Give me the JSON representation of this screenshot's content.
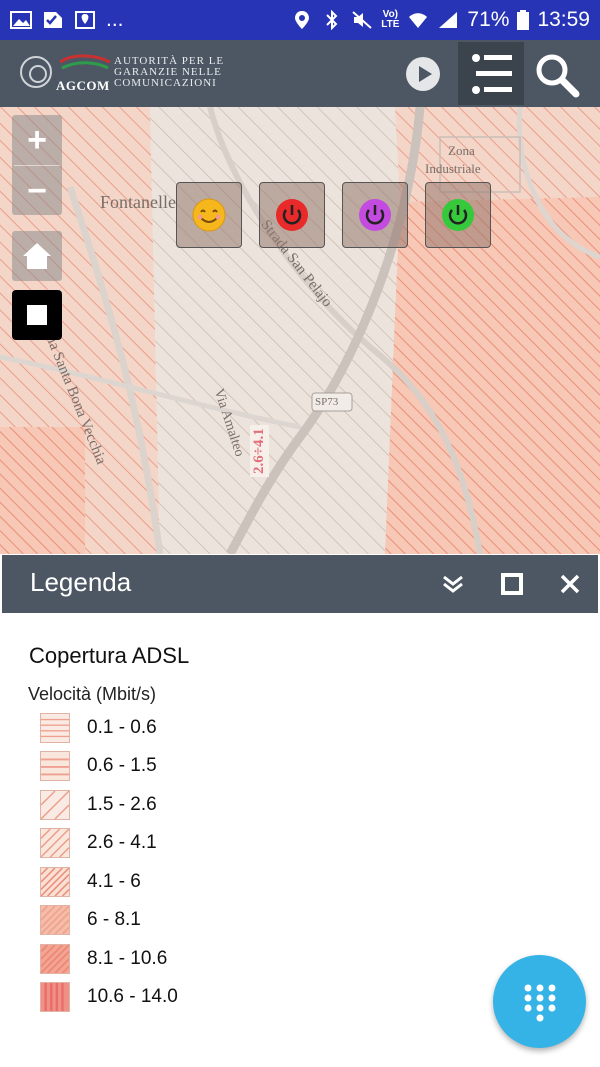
{
  "status_bar": {
    "dots": "...",
    "network_top": "Vo)",
    "network_bottom": "LTE",
    "battery": "71%",
    "time": "13:59"
  },
  "header": {
    "logo_lines": [
      "AUTORITÀ PER LE",
      "GARANZIE NELLE",
      "COMUNICAZIONI"
    ],
    "logo_brand": "AGCOM",
    "play_icon": "play-circle-icon",
    "list_icon": "layer-list-icon",
    "search_icon": "search-icon"
  },
  "map": {
    "labels": {
      "place": "Fontanelle",
      "zone_line1": "Zona",
      "zone_line2": "Industriale",
      "road1": "Via Santa Bona Vecchia",
      "road2": "Strada San Pelajo",
      "road3": "Via Amalteo",
      "road4": "SP73",
      "speed_label": "2.6÷4.1"
    },
    "controls": {
      "zoom_in": "+",
      "zoom_out": "−",
      "home_icon": "home-icon",
      "stop_icon": "stop-icon"
    },
    "tools": [
      {
        "name": "smiley-icon",
        "color": "#f6b71c"
      },
      {
        "name": "power-red-icon",
        "color": "#e82a2a"
      },
      {
        "name": "power-purple-icon",
        "color": "#c34be0"
      },
      {
        "name": "power-green-icon",
        "color": "#35c93b"
      }
    ]
  },
  "legend": {
    "title": "Legenda",
    "layer_title": "Copertura ADSL",
    "field_title": "Velocità (Mbit/s)",
    "collapse_icon": "chevron-double-down-icon",
    "maximize_icon": "maximize-icon",
    "close_icon": "close-icon",
    "items": [
      {
        "label": "0.1 - 0.6",
        "pattern": "horizontal",
        "color": "#f0a090"
      },
      {
        "label": "0.6 - 1.5",
        "pattern": "horizontal",
        "color": "#f0a090"
      },
      {
        "label": "1.5 - 2.6",
        "pattern": "diagonal-sparse",
        "color": "#ec9a88"
      },
      {
        "label": "2.6 - 4.1",
        "pattern": "diagonal",
        "color": "#ec9a88"
      },
      {
        "label": "4.1 - 6",
        "pattern": "diagonal-dense",
        "color": "#ea8c78"
      },
      {
        "label": "6 - 8.1",
        "pattern": "diagonal-fill",
        "color": "#f0a48e"
      },
      {
        "label": "8.1 - 10.6",
        "pattern": "diagonal-fill-dark",
        "color": "#ee8877"
      },
      {
        "label": "10.6 - 14.0",
        "pattern": "vertical",
        "color": "#e86d68"
      }
    ]
  },
  "fab": {
    "icon": "dialpad-icon"
  }
}
